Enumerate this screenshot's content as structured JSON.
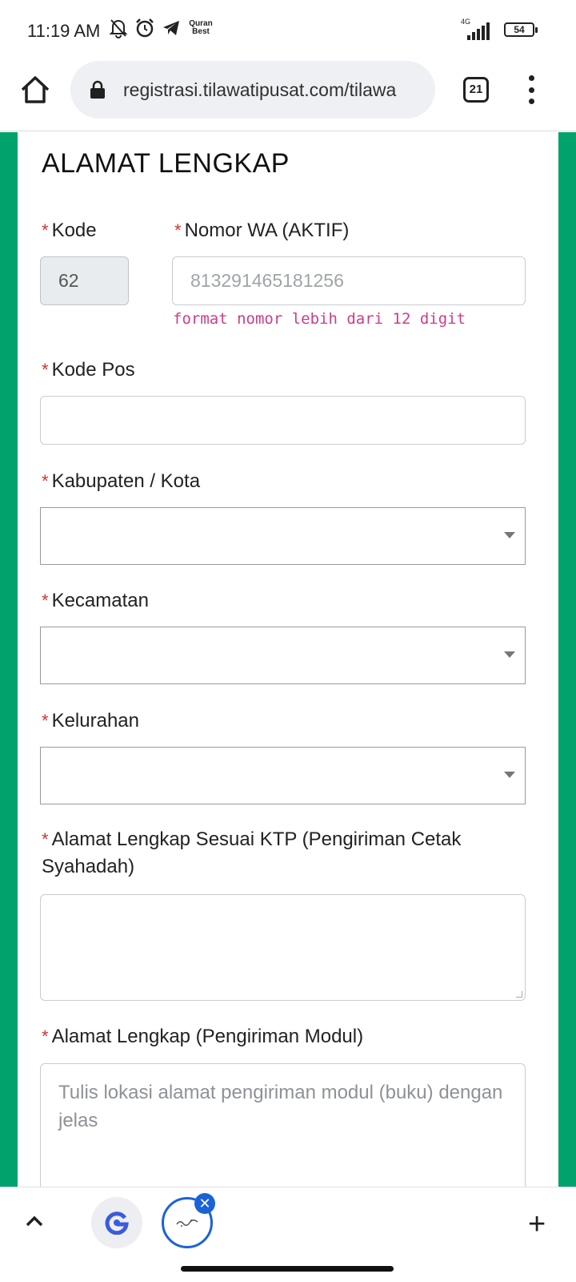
{
  "status_bar": {
    "time": "11:19 AM",
    "app_badge": "Quran Best",
    "network": "4G",
    "battery": "54"
  },
  "browser": {
    "url": "registrasi.tilawatipusat.com/tilawa",
    "tab_count": "21"
  },
  "form": {
    "section_title": "ALAMAT LENGKAP",
    "required_marker": "*",
    "kode": {
      "label": "Kode",
      "value": "62"
    },
    "nomor_wa": {
      "label": "Nomor WA (AKTIF)",
      "placeholder": "813291465181256",
      "hint": "format nomor lebih dari 12 digit"
    },
    "kode_pos": {
      "label": "Kode Pos",
      "value": ""
    },
    "kabupaten": {
      "label": "Kabupaten / Kota",
      "value": ""
    },
    "kecamatan": {
      "label": "Kecamatan",
      "value": ""
    },
    "kelurahan": {
      "label": "Kelurahan",
      "value": ""
    },
    "alamat_ktp": {
      "label": "Alamat Lengkap Sesuai KTP (Pengiriman Cetak Syahadah)",
      "value": ""
    },
    "alamat_modul": {
      "label": "Alamat Lengkap (Pengiriman Modul)",
      "placeholder": "Tulis lokasi alamat pengiriman modul (buku) dengan jelas"
    }
  },
  "colors": {
    "page_accent": "#00a36c",
    "required": "#d0342c",
    "hint": "#cc3d88",
    "active_tab": "#1a63d6"
  },
  "icons": [
    "silent-bell-icon",
    "alarm-icon",
    "telegram-icon",
    "home-icon",
    "lock-icon",
    "overflow-menu-icon",
    "chevron-up-icon",
    "google-icon",
    "close-icon",
    "plus-icon"
  ]
}
